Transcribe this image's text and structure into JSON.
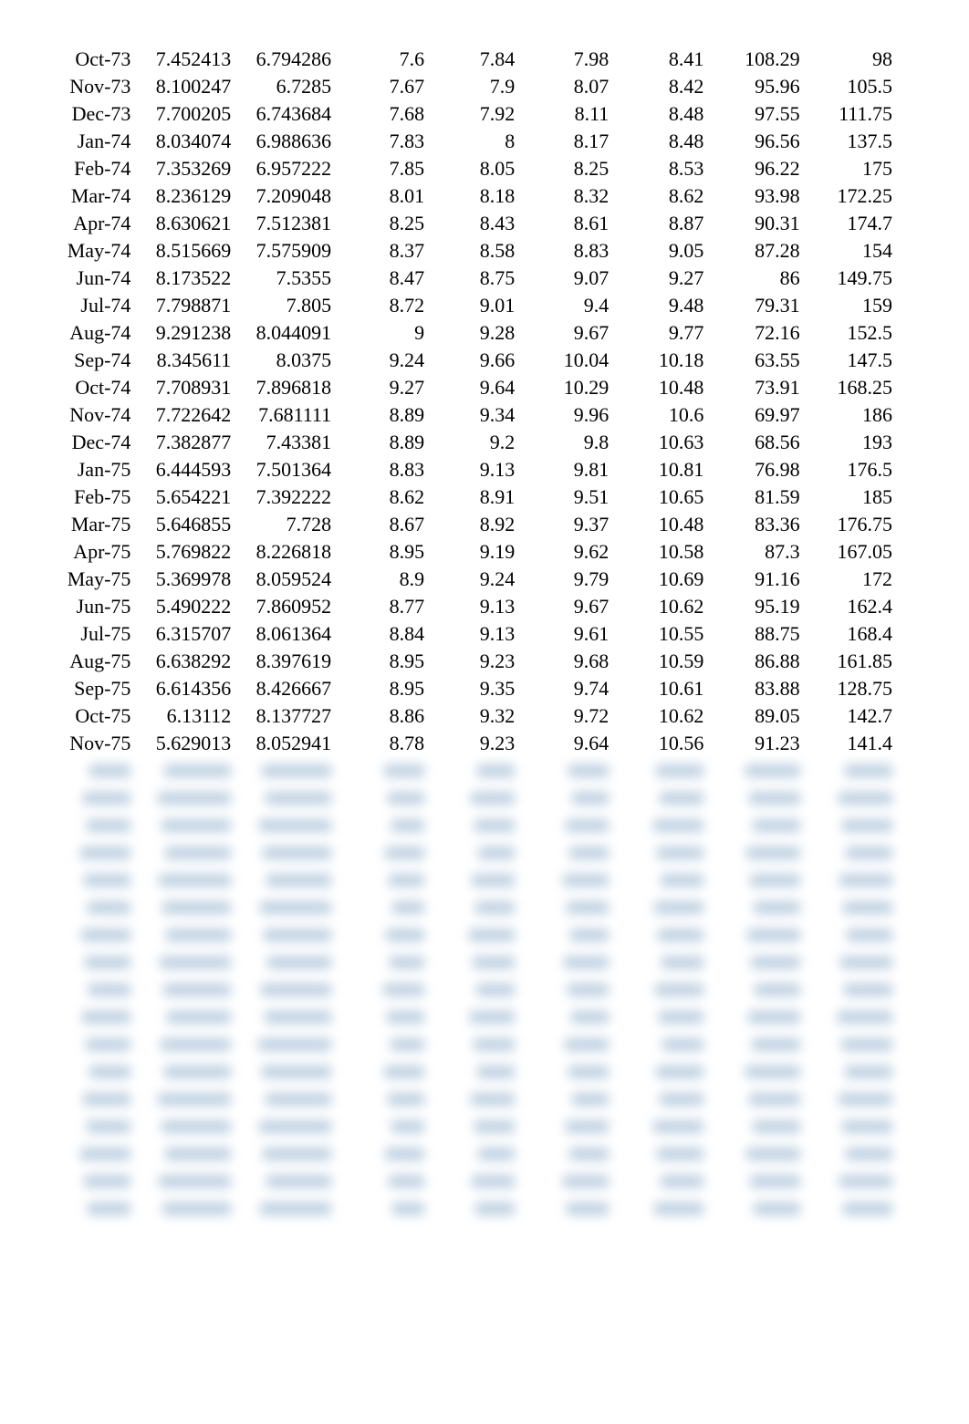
{
  "table": {
    "rows": [
      {
        "label": "Oct-73",
        "values": [
          "7.452413",
          "6.794286",
          "7.6",
          "7.84",
          "7.98",
          "8.41",
          "108.29",
          "98"
        ]
      },
      {
        "label": "Nov-73",
        "values": [
          "8.100247",
          "6.7285",
          "7.67",
          "7.9",
          "8.07",
          "8.42",
          "95.96",
          "105.5"
        ]
      },
      {
        "label": "Dec-73",
        "values": [
          "7.700205",
          "6.743684",
          "7.68",
          "7.92",
          "8.11",
          "8.48",
          "97.55",
          "111.75"
        ]
      },
      {
        "label": "Jan-74",
        "values": [
          "8.034074",
          "6.988636",
          "7.83",
          "8",
          "8.17",
          "8.48",
          "96.56",
          "137.5"
        ]
      },
      {
        "label": "Feb-74",
        "values": [
          "7.353269",
          "6.957222",
          "7.85",
          "8.05",
          "8.25",
          "8.53",
          "96.22",
          "175"
        ]
      },
      {
        "label": "Mar-74",
        "values": [
          "8.236129",
          "7.209048",
          "8.01",
          "8.18",
          "8.32",
          "8.62",
          "93.98",
          "172.25"
        ]
      },
      {
        "label": "Apr-74",
        "values": [
          "8.630621",
          "7.512381",
          "8.25",
          "8.43",
          "8.61",
          "8.87",
          "90.31",
          "174.7"
        ]
      },
      {
        "label": "May-74",
        "values": [
          "8.515669",
          "7.575909",
          "8.37",
          "8.58",
          "8.83",
          "9.05",
          "87.28",
          "154"
        ]
      },
      {
        "label": "Jun-74",
        "values": [
          "8.173522",
          "7.5355",
          "8.47",
          "8.75",
          "9.07",
          "9.27",
          "86",
          "149.75"
        ]
      },
      {
        "label": "Jul-74",
        "values": [
          "7.798871",
          "7.805",
          "8.72",
          "9.01",
          "9.4",
          "9.48",
          "79.31",
          "159"
        ]
      },
      {
        "label": "Aug-74",
        "values": [
          "9.291238",
          "8.044091",
          "9",
          "9.28",
          "9.67",
          "9.77",
          "72.16",
          "152.5"
        ]
      },
      {
        "label": "Sep-74",
        "values": [
          "8.345611",
          "8.0375",
          "9.24",
          "9.66",
          "10.04",
          "10.18",
          "63.55",
          "147.5"
        ]
      },
      {
        "label": "Oct-74",
        "values": [
          "7.708931",
          "7.896818",
          "9.27",
          "9.64",
          "10.29",
          "10.48",
          "73.91",
          "168.25"
        ]
      },
      {
        "label": "Nov-74",
        "values": [
          "7.722642",
          "7.681111",
          "8.89",
          "9.34",
          "9.96",
          "10.6",
          "69.97",
          "186"
        ]
      },
      {
        "label": "Dec-74",
        "values": [
          "7.382877",
          "7.43381",
          "8.89",
          "9.2",
          "9.8",
          "10.63",
          "68.56",
          "193"
        ]
      },
      {
        "label": "Jan-75",
        "values": [
          "6.444593",
          "7.501364",
          "8.83",
          "9.13",
          "9.81",
          "10.81",
          "76.98",
          "176.5"
        ]
      },
      {
        "label": "Feb-75",
        "values": [
          "5.654221",
          "7.392222",
          "8.62",
          "8.91",
          "9.51",
          "10.65",
          "81.59",
          "185"
        ]
      },
      {
        "label": "Mar-75",
        "values": [
          "5.646855",
          "7.728",
          "8.67",
          "8.92",
          "9.37",
          "10.48",
          "83.36",
          "176.75"
        ]
      },
      {
        "label": "Apr-75",
        "values": [
          "5.769822",
          "8.226818",
          "8.95",
          "9.19",
          "9.62",
          "10.58",
          "87.3",
          "167.05"
        ]
      },
      {
        "label": "May-75",
        "values": [
          "5.369978",
          "8.059524",
          "8.9",
          "9.24",
          "9.79",
          "10.69",
          "91.16",
          "172"
        ]
      },
      {
        "label": "Jun-75",
        "values": [
          "5.490222",
          "7.860952",
          "8.77",
          "9.13",
          "9.67",
          "10.62",
          "95.19",
          "162.4"
        ]
      },
      {
        "label": "Jul-75",
        "values": [
          "6.315707",
          "8.061364",
          "8.84",
          "9.13",
          "9.61",
          "10.55",
          "88.75",
          "168.4"
        ]
      },
      {
        "label": "Aug-75",
        "values": [
          "6.638292",
          "8.397619",
          "8.95",
          "9.23",
          "9.68",
          "10.59",
          "86.88",
          "161.85"
        ]
      },
      {
        "label": "Sep-75",
        "values": [
          "6.614356",
          "8.426667",
          "8.95",
          "9.35",
          "9.74",
          "10.61",
          "83.88",
          "128.75"
        ]
      },
      {
        "label": "Oct-75",
        "values": [
          "6.13112",
          "8.137727",
          "8.86",
          "9.32",
          "9.72",
          "10.62",
          "89.05",
          "142.7"
        ]
      },
      {
        "label": "Nov-75",
        "values": [
          "5.629013",
          "8.052941",
          "8.78",
          "9.23",
          "9.64",
          "10.56",
          "91.23",
          "141.4"
        ]
      }
    ],
    "blurredRowCount": 17,
    "columnCount": 9
  }
}
